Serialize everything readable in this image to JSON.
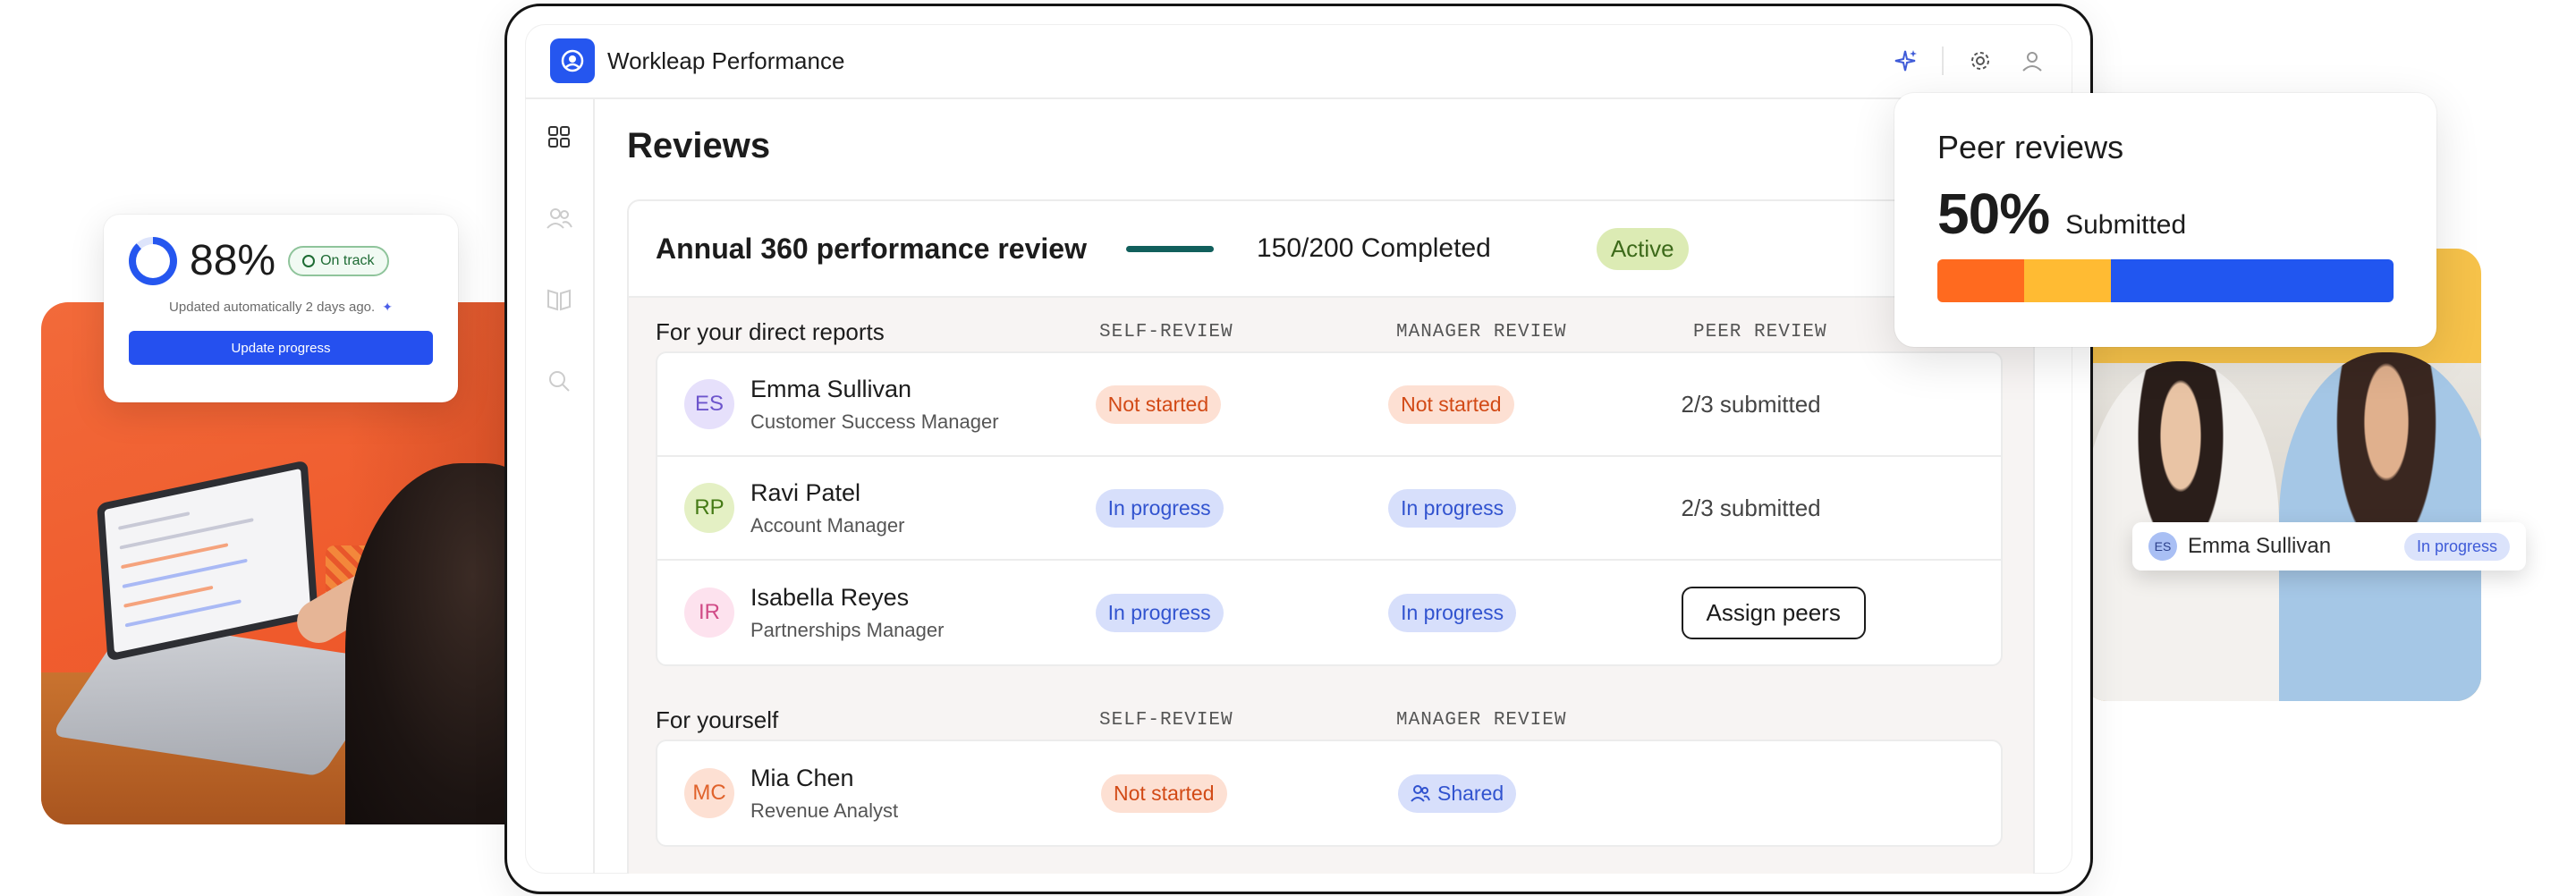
{
  "app": {
    "name": "Workleap Performance",
    "page_title": "Reviews"
  },
  "review": {
    "title": "Annual 360 performance review",
    "progress": 0.75,
    "completed_text": "150/200 Completed",
    "status": "Active"
  },
  "direct_reports": {
    "title": "For your direct reports",
    "columns": [
      "SELF-REVIEW",
      "MANAGER REVIEW",
      "PEER REVIEW"
    ],
    "rows": [
      {
        "initials": "ES",
        "name": "Emma Sullivan",
        "role": "Customer Success Manager",
        "self": "Not started",
        "manager": "Not started",
        "peer": "2/3 submitted"
      },
      {
        "initials": "RP",
        "name": "Ravi Patel",
        "role": "Account Manager",
        "self": "In progress",
        "manager": "In progress",
        "peer": "2/3 submitted"
      },
      {
        "initials": "IR",
        "name": "Isabella Reyes",
        "role": "Partnerships Manager",
        "self": "In progress",
        "manager": "In progress",
        "peer_action": "Assign peers"
      }
    ]
  },
  "yourself": {
    "title": "For yourself",
    "columns": [
      "SELF-REVIEW",
      "MANAGER REVIEW"
    ],
    "rows": [
      {
        "initials": "MC",
        "name": "Mia Chen",
        "role": "Revenue Analyst",
        "self": "Not started",
        "manager": "Shared"
      }
    ]
  },
  "goal_card": {
    "percent": "88%",
    "progress": 0.88,
    "status": "On track",
    "updated": "Updated automatically 2 days ago.",
    "button": "Update progress"
  },
  "peer_card": {
    "title": "Peer reviews",
    "percent": "50%",
    "label": "Submitted",
    "segments": [
      {
        "share": 0.19,
        "color": "#ff6a1f"
      },
      {
        "share": 0.19,
        "color": "#ffbb33"
      },
      {
        "share": 0.62,
        "color": "#2156f0"
      }
    ]
  },
  "chip": {
    "initials": "ES",
    "name": "Emma Sullivan",
    "status": "In progress"
  },
  "colors": {
    "brand": "#2556ef",
    "active_bg": "#dcebb4",
    "not_started_bg": "#fde0d3",
    "in_progress_bg": "#d7dffb"
  }
}
